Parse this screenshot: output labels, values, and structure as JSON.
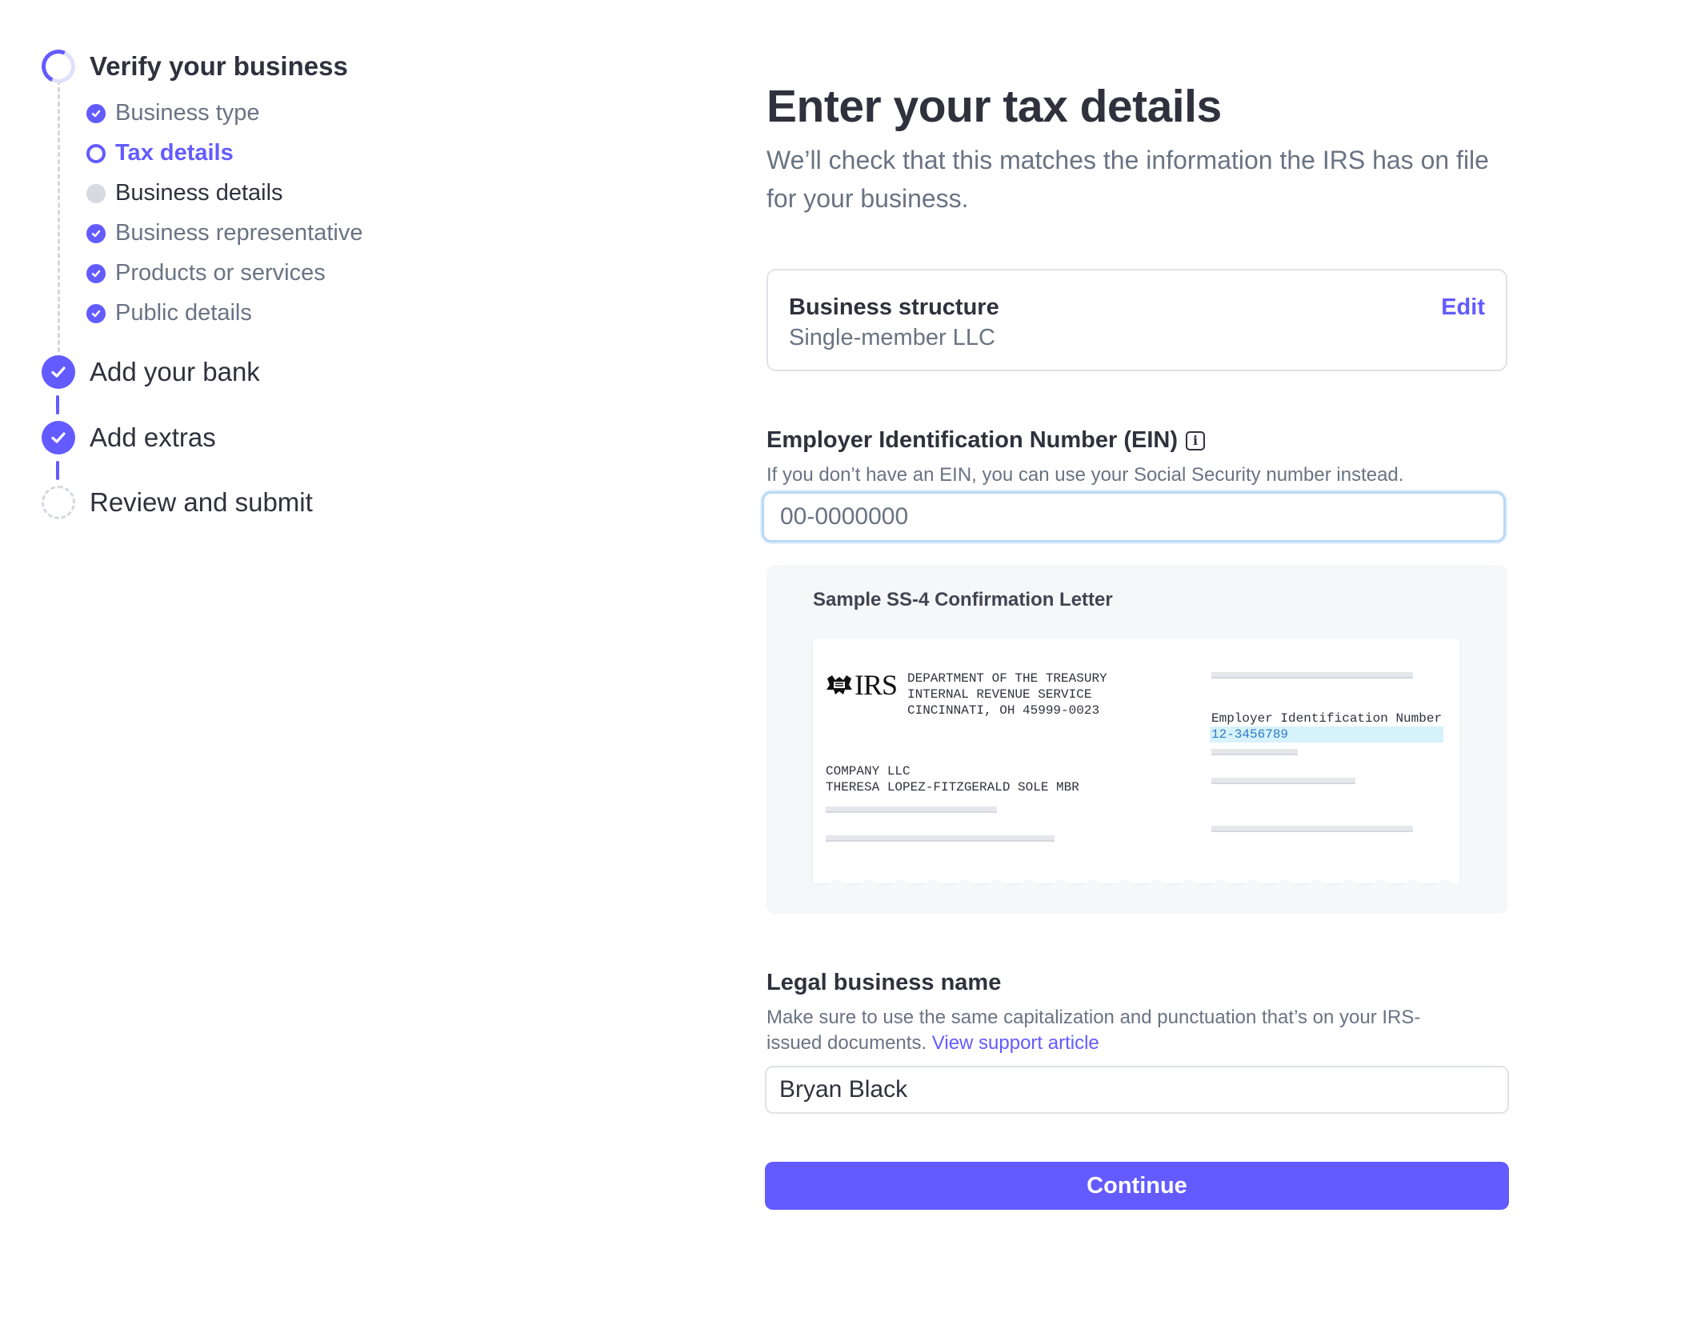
{
  "sidebar": {
    "steps": [
      {
        "label": "Verify your business"
      },
      {
        "label": "Add your bank"
      },
      {
        "label": "Add extras"
      },
      {
        "label": "Review and submit"
      }
    ],
    "substeps": [
      {
        "label": "Business type"
      },
      {
        "label": "Tax details"
      },
      {
        "label": "Business details"
      },
      {
        "label": "Business representative"
      },
      {
        "label": "Products or services"
      },
      {
        "label": "Public details"
      }
    ]
  },
  "main": {
    "title": "Enter your tax details",
    "subtitle": "We’ll check that this matches the information the IRS has on file for your business.",
    "structure": {
      "label": "Business structure",
      "value": "Single-member LLC",
      "edit_label": "Edit"
    },
    "ein": {
      "label": "Employer Identification Number (EIN)",
      "info_icon": "i",
      "help": "If you don’t have an EIN, you can use your Social Security number instead.",
      "placeholder": "00-0000000",
      "value": ""
    },
    "sample": {
      "caption": "Sample SS-4 Confirmation Letter",
      "irs_logo": "IRS",
      "address": "DEPARTMENT OF THE TREASURY\nINTERNAL REVENUE SERVICE\nCINCINNATI, OH 45999-0023",
      "company": "COMPANY LLC\nTHERESA LOPEZ-FITZGERALD SOLE MBR",
      "ein_label": "Employer Identification Number",
      "ein_value": "12-3456789"
    },
    "legal_name": {
      "label": "Legal business name",
      "help": "Make sure to use the same capitalization and punctuation that’s on your IRS-issued documents.",
      "link": "View support article",
      "value": "Bryan Black"
    },
    "continue_label": "Continue"
  },
  "colors": {
    "accent": "#635bff",
    "text": "#30313d",
    "muted": "#6a7383",
    "focus_ring": "#b9d9f5"
  }
}
